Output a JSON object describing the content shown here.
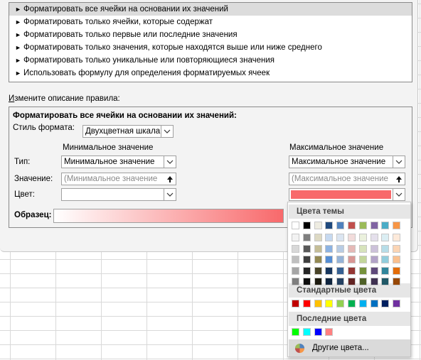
{
  "rule_types": [
    {
      "label": "Форматировать все ячейки на основании их значений",
      "selected": true
    },
    {
      "label": "Форматировать только ячейки, которые содержат",
      "selected": false
    },
    {
      "label": "Форматировать только первые или последние значения",
      "selected": false
    },
    {
      "label": "Форматировать только значения, которые находятся выше или ниже среднего",
      "selected": false
    },
    {
      "label": "Форматировать только уникальные или повторяющиеся значения",
      "selected": false
    },
    {
      "label": "Использовать формулу для определения форматируемых ячеек",
      "selected": false
    }
  ],
  "rule_arrow": "►",
  "description": {
    "label_underlined": "И",
    "label_rest": "змените описание правила:",
    "heading": "Форматировать все ячейки на основании их значений:",
    "style_label": "Стиль формата:",
    "style_value": "Двухцветная шкала",
    "min_header": "Минимальное значение",
    "max_header": "Максимальное значение",
    "type_label": "Тип:",
    "value_label": "Значение:",
    "color_label": "Цвет:",
    "min_type": "Минимальное значение",
    "max_type": "Максимальное значение",
    "min_value_placeholder": "(Минимальное значение",
    "max_value_placeholder": "(Максимальное значение",
    "min_color": "#ffffff",
    "max_color": "#f8696b",
    "preview_label": "Образец:"
  },
  "palette": {
    "theme_label": "Цвета темы",
    "standard_label": "Стандартные цвета",
    "recent_label": "Последние цвета",
    "more_label": "Другие цвета...",
    "theme_top": [
      "#ffffff",
      "#000000",
      "#eeece1",
      "#1f497d",
      "#4f81bd",
      "#c0504d",
      "#9bbb59",
      "#8064a2",
      "#4bacc6",
      "#f79646"
    ],
    "theme_shades": [
      [
        "#f2f2f2",
        "#7f7f7f",
        "#ddd9c3",
        "#c6d9f0",
        "#dbe5f1",
        "#f2dcdb",
        "#ebf1dd",
        "#e5e0ec",
        "#dbeef3",
        "#fdeada"
      ],
      [
        "#d8d8d8",
        "#595959",
        "#c4bd97",
        "#8db3e2",
        "#b8cce4",
        "#e5b9b7",
        "#d7e3bc",
        "#ccc1d9",
        "#b7dde8",
        "#fbd5b5"
      ],
      [
        "#bfbfbf",
        "#3f3f3f",
        "#938953",
        "#548dd4",
        "#95b3d7",
        "#d99694",
        "#c3d69b",
        "#b2a2c7",
        "#92cddc",
        "#fac08f"
      ],
      [
        "#a5a5a5",
        "#262626",
        "#494429",
        "#17365d",
        "#366092",
        "#953734",
        "#76923c",
        "#5f497a",
        "#31859b",
        "#e36c09"
      ],
      [
        "#7f7f7f",
        "#0c0c0c",
        "#1d1b10",
        "#0f243e",
        "#244061",
        "#632423",
        "#4f6128",
        "#3f3151",
        "#205867",
        "#974806"
      ]
    ],
    "standard": [
      "#c00000",
      "#ff0000",
      "#ffc000",
      "#ffff00",
      "#92d050",
      "#00b050",
      "#00b0f0",
      "#0070c0",
      "#002060",
      "#7030a0"
    ],
    "recent": [
      "#00ff00",
      "#00ffff",
      "#0000ff",
      "#ff8080"
    ]
  }
}
